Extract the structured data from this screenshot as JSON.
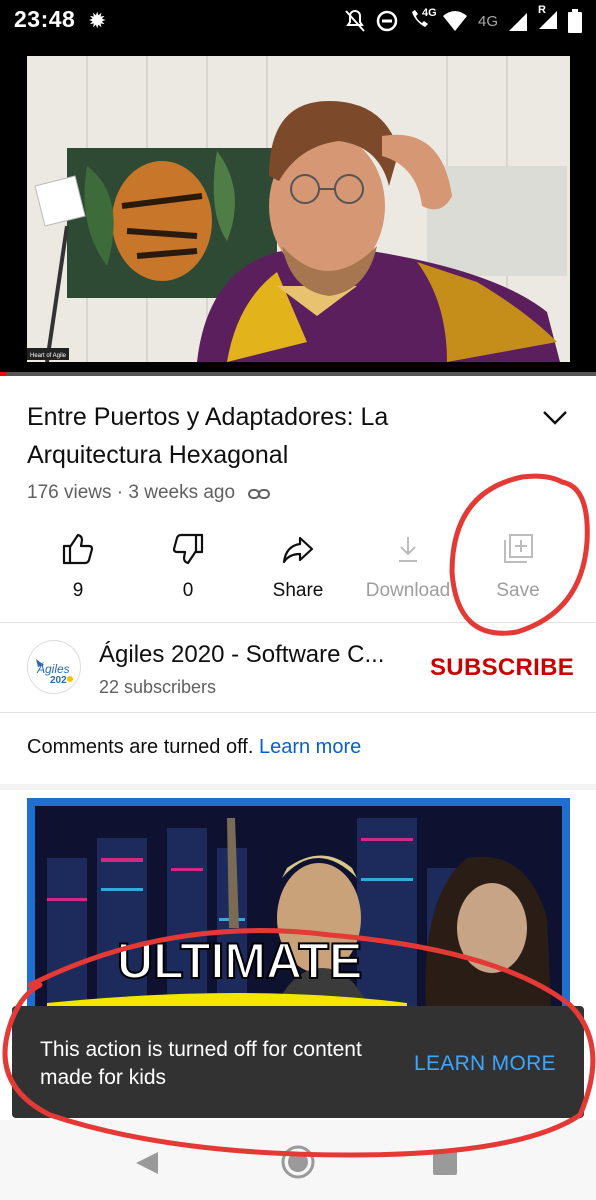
{
  "status_bar": {
    "time": "23:48",
    "network_4g_label": "4G",
    "call_4g_label": "4G",
    "roaming_label": "R"
  },
  "video": {
    "watermark": "Heart of Agile",
    "progress": 0.01
  },
  "title": "Entre Puertos y Adaptadores: La Arquitectura Hexagonal",
  "meta": {
    "views": "176 views",
    "separator": " · ",
    "age": "3 weeks ago"
  },
  "actions": [
    {
      "icon": "thumbs-up-icon",
      "label": "9"
    },
    {
      "icon": "thumbs-down-icon",
      "label": "0"
    },
    {
      "icon": "share-icon",
      "label": "Share"
    },
    {
      "icon": "download-icon",
      "label": "Download"
    },
    {
      "icon": "save-icon",
      "label": "Save"
    }
  ],
  "channel": {
    "name": "Ágiles 2020 - Software C...",
    "subscribers": "22 subscribers",
    "subscribe_label": "SUBSCRIBE",
    "avatar_text": "Ágiles",
    "avatar_year": "202"
  },
  "comments": {
    "text": "Comments are turned off. ",
    "link": "Learn more"
  },
  "next_video": {
    "overlay_text": "ULTIMATE"
  },
  "snackbar": {
    "message": "This action is turned off for content made for kids",
    "action": "LEARN MORE"
  },
  "colors": {
    "subscribe": "#cc0000",
    "link": "#065fd4",
    "snackbar_bg": "#323232",
    "snackbar_action": "#3ea6ff",
    "annotation": "#e53935"
  }
}
